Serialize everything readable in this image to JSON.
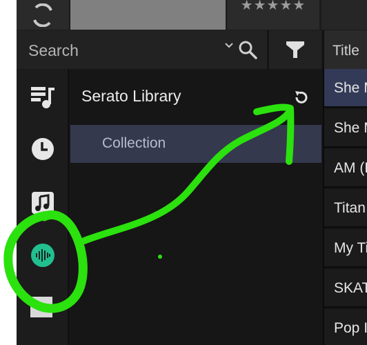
{
  "header": {
    "rating_stars": "★★★★★"
  },
  "search": {
    "placeholder": "Search"
  },
  "columns": {
    "title": "Title"
  },
  "sidebar": {
    "items": [
      {
        "icon": "playlist-icon"
      },
      {
        "icon": "history-clock-icon"
      },
      {
        "icon": "music-note-icon"
      },
      {
        "icon": "spotify-waveform-icon"
      }
    ]
  },
  "library": {
    "title": "Serato Library",
    "items": [
      {
        "label": "Collection"
      }
    ]
  },
  "tracks": [
    {
      "title": "She M"
    },
    {
      "title": "She M"
    },
    {
      "title": "AM (D"
    },
    {
      "title": "Titan"
    },
    {
      "title": "My Ti"
    },
    {
      "title": "SKAT"
    },
    {
      "title": "Pop I"
    }
  ],
  "colors": {
    "annotation_green": "#2be10e",
    "selected_row": "#34394e",
    "spotify_icon_green": "#22c08f"
  }
}
